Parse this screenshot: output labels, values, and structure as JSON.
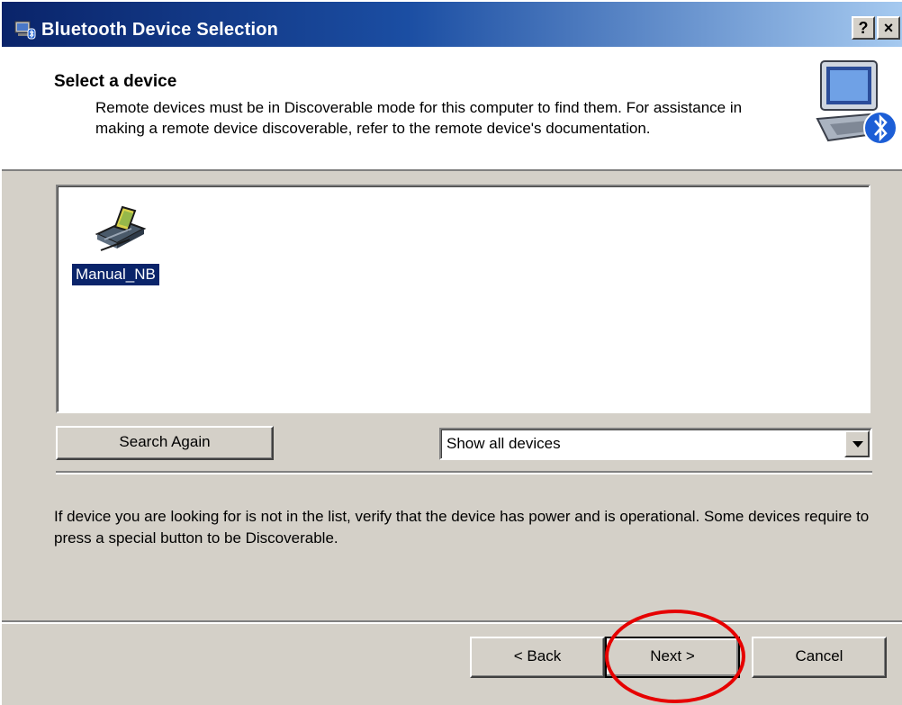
{
  "window": {
    "title": "Bluetooth Device Selection",
    "help_label": "?",
    "close_label": "×"
  },
  "header": {
    "heading": "Select a device",
    "description": "Remote devices must be in Discoverable mode for this computer to find them. For assistance in making a remote device discoverable, refer to the remote device's documentation."
  },
  "devices": [
    {
      "label": "Manual_NB",
      "icon": "pda-device-icon",
      "selected": true
    }
  ],
  "controls": {
    "search_again_label": "Search Again",
    "filter_value": "Show all devices"
  },
  "info_text": "If device you are looking for is not in the list, verify that the device has power and is operational. Some devices require to press a special button to be Discoverable.",
  "footer": {
    "back_label": "< Back",
    "next_label": "Next >",
    "cancel_label": "Cancel"
  },
  "colors": {
    "titlebar_start": "#0a246a",
    "face": "#d4d0c8",
    "selection": "#0a246a",
    "annotation": "#e60000"
  }
}
